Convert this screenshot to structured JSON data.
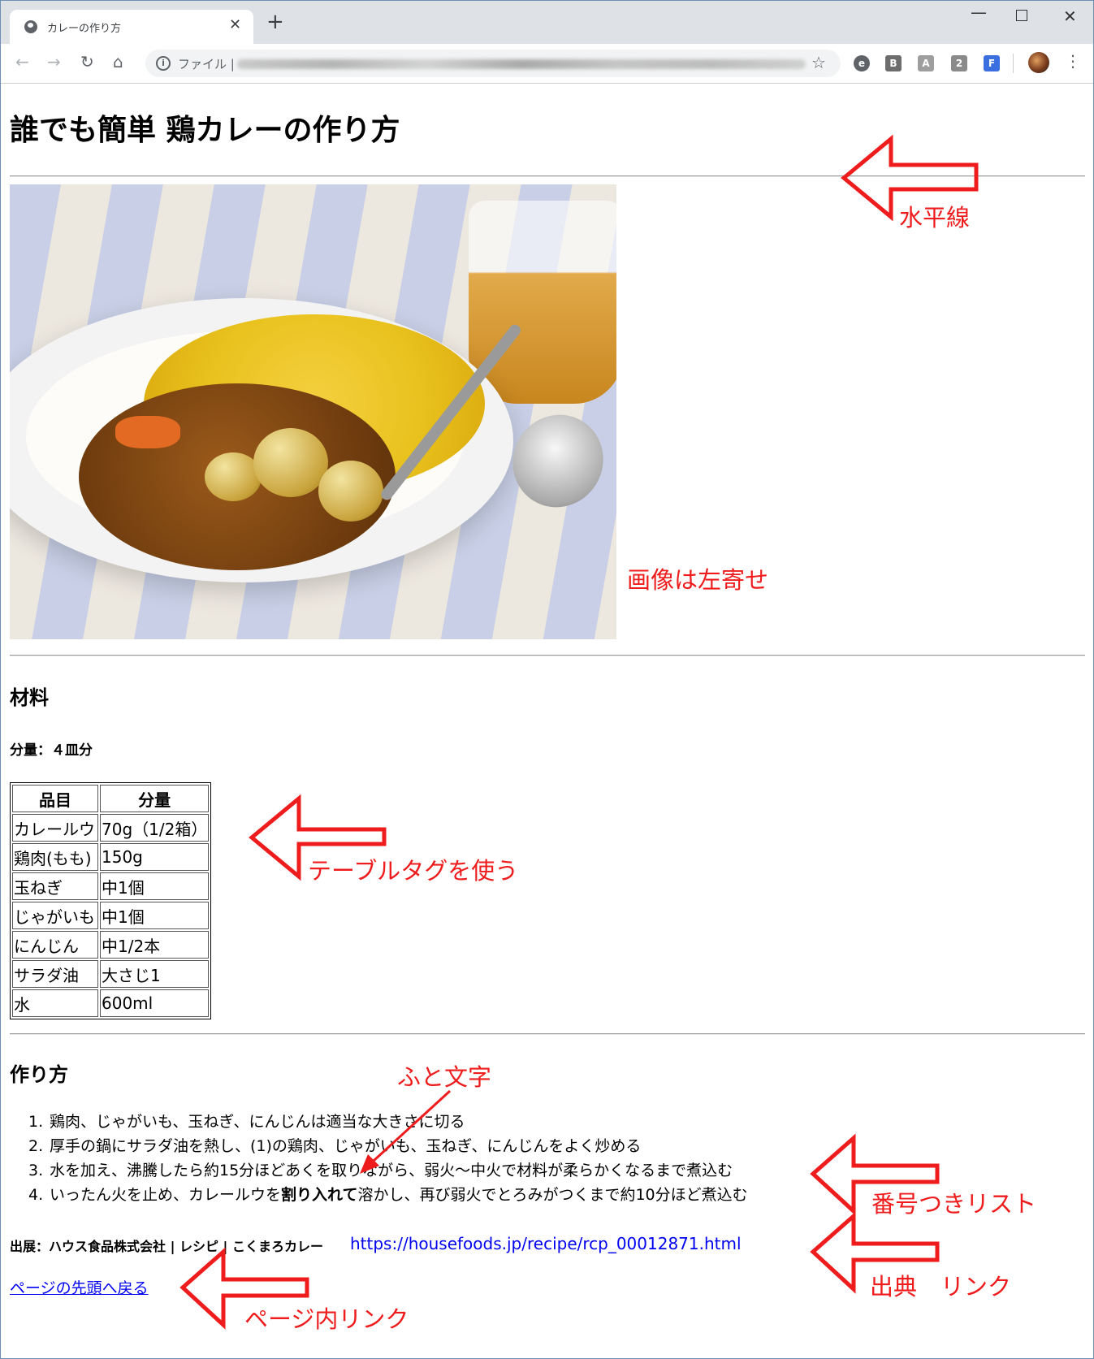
{
  "browser": {
    "tab_title": "カレーの作り方",
    "tab_close": "✕",
    "new_tab": "+",
    "window_controls": {
      "minimize": "—",
      "close": "✕"
    },
    "toolbar": {
      "back": "←",
      "forward": "→",
      "reload": "↻",
      "home": "⌂",
      "menu": "⋮",
      "star": "☆"
    },
    "address_scheme": "ファイル |",
    "address_info": "i",
    "extensions": [
      "e",
      "B",
      "A",
      "2",
      "F"
    ]
  },
  "page": {
    "title": "誰でも簡単 鶏カレーの作り方",
    "ingredients_heading": "材料",
    "servings": "分量：４皿分",
    "table": {
      "headers": [
        "品目",
        "分量"
      ],
      "rows": [
        [
          "カレールウ",
          "70g（1/2箱）"
        ],
        [
          "鶏肉(もも)",
          "150g"
        ],
        [
          "玉ねぎ",
          "中1個"
        ],
        [
          "じゃがいも",
          "中1個"
        ],
        [
          "にんじん",
          "中1/2本"
        ],
        [
          "サラダ油",
          "大さじ1"
        ],
        [
          "水",
          "600ml"
        ]
      ]
    },
    "method_heading": "作り方",
    "steps": [
      {
        "num": "1.",
        "text": "鶏肉、じゃがいも、玉ねぎ、にんじんは適当な大きさに切る"
      },
      {
        "num": "2.",
        "text": "厚手の鍋にサラダ油を熱し、(1)の鶏肉、じゃがいも、玉ねぎ、にんじんをよく炒める"
      },
      {
        "num": "3.",
        "text": "水を加え、沸騰したら約15分ほどあくを取りながら、弱火〜中火で材料が柔らかくなるまで煮込む"
      },
      {
        "num": "4.",
        "before": "いったん火を止め、カレールウを",
        "bold": "割り入れて",
        "after": "溶かし、再び弱火でとろみがつくまで約10分ほど煮込む"
      }
    ],
    "source_text": "出展：ハウス食品株式会社 | レシピ | こくまろカレー",
    "source_link": "https://housefoods.jp/recipe/rcp_00012871.html",
    "top_link": "ページの先頭へ戻る"
  },
  "annotations": {
    "hr": "水平線",
    "image_left": "画像は左寄せ",
    "table": "テーブルタグを使う",
    "bold": "ふと文字",
    "ordered_list": "番号つきリスト",
    "source_link": "出典　リンク",
    "page_link": "ページ内リンク",
    "color": "#ee1c1c"
  },
  "colors": {
    "link": "#0000ee",
    "annotation": "#ee1c1c",
    "tab_bar": "#dee1e6"
  }
}
